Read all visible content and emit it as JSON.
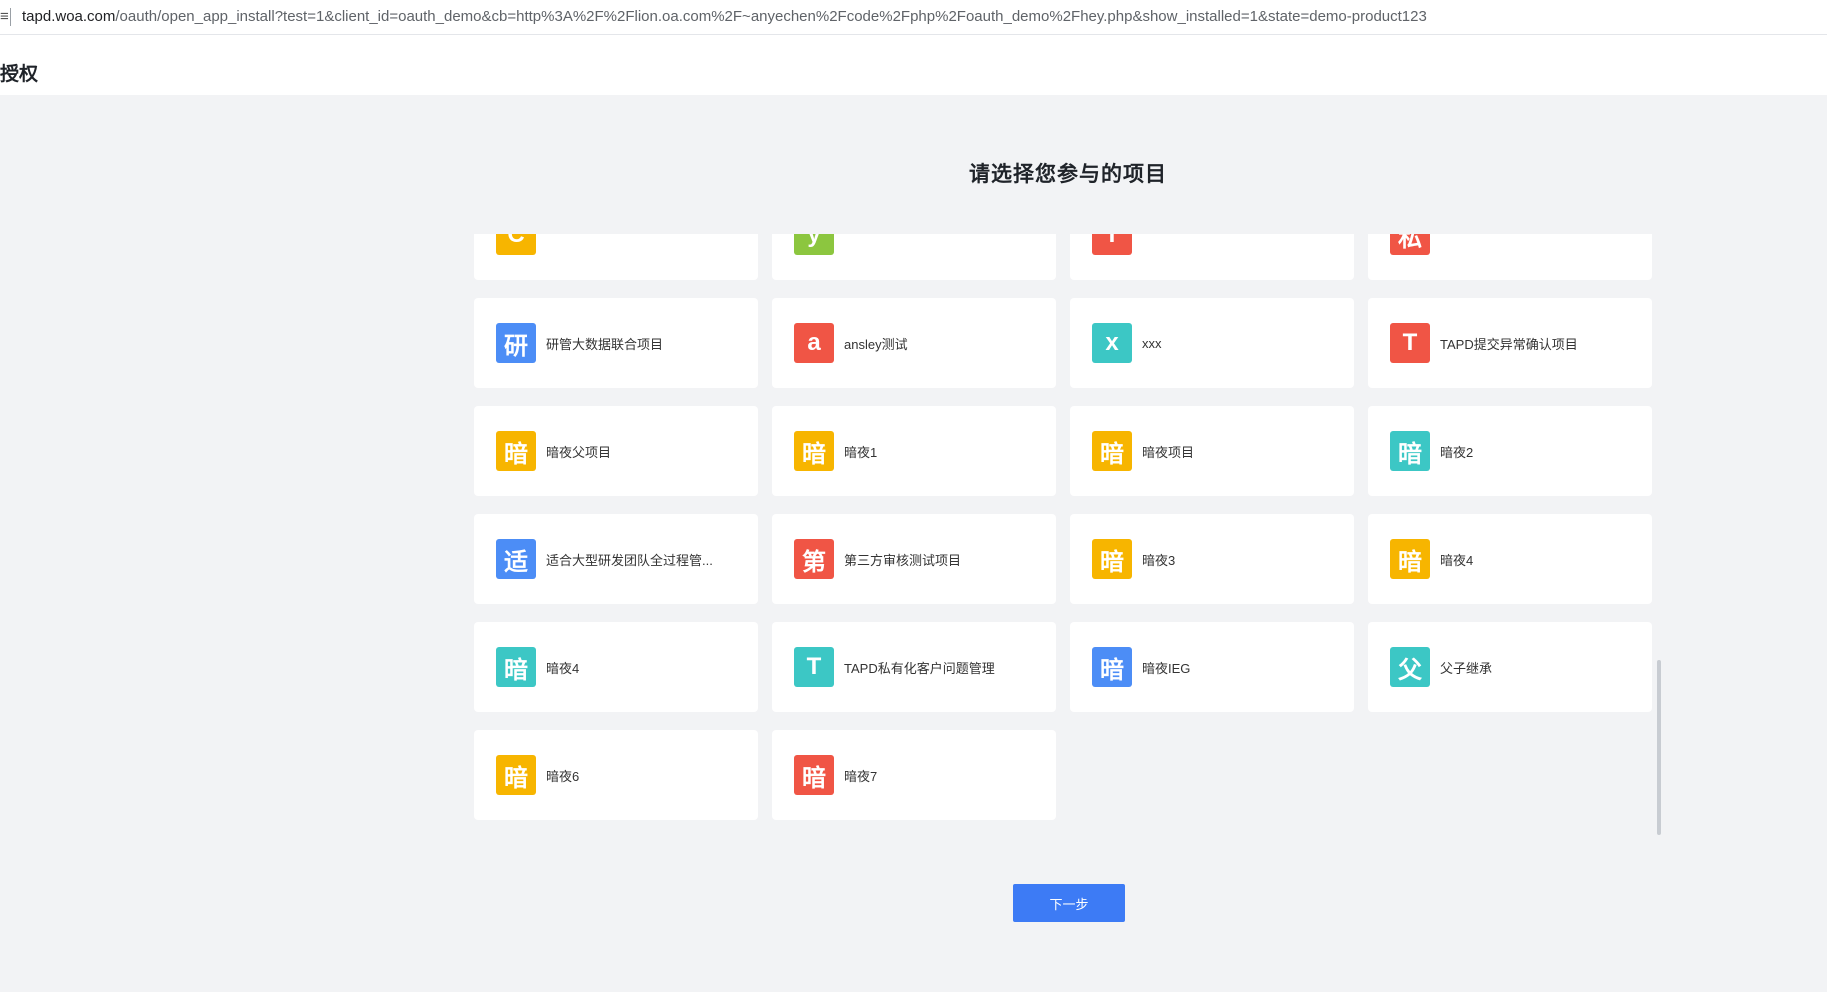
{
  "browser": {
    "prefix": "≡",
    "url_host": "tapd.woa.com",
    "url_path": "/oauth/open_app_install?test=1&client_id=oauth_demo&cb=http%3A%2F%2Flion.oa.com%2F~anyechen%2Fcode%2Fphp%2Foauth_demo%2Fhey.php&show_installed=1&state=demo-product123"
  },
  "header": {
    "title": "授权"
  },
  "main": {
    "title": "请选择您参与的项目",
    "next_label": "下一步"
  },
  "projects": [
    {
      "icon": "C",
      "name": "",
      "color": "#f7b500"
    },
    {
      "icon": "y",
      "name": "",
      "color": "#8cc63f"
    },
    {
      "icon": "T",
      "name": "",
      "color": "#f05545"
    },
    {
      "icon": "私",
      "name": "",
      "color": "#f05545"
    },
    {
      "icon": "研",
      "name": "研管大数据联合项目",
      "color": "#4c8df6"
    },
    {
      "icon": "a",
      "name": "ansley测试",
      "color": "#f05545"
    },
    {
      "icon": "x",
      "name": "xxx",
      "color": "#3cc7c5"
    },
    {
      "icon": "T",
      "name": "TAPD提交异常确认项目",
      "color": "#f05545"
    },
    {
      "icon": "暗",
      "name": "暗夜父项目",
      "color": "#f7b500"
    },
    {
      "icon": "暗",
      "name": "暗夜1",
      "color": "#f7b500"
    },
    {
      "icon": "暗",
      "name": "暗夜项目",
      "color": "#f7b500"
    },
    {
      "icon": "暗",
      "name": "暗夜2",
      "color": "#3cc7c5"
    },
    {
      "icon": "适",
      "name": "适合大型研发团队全过程管...",
      "color": "#4c8df6"
    },
    {
      "icon": "第",
      "name": "第三方审核测试项目",
      "color": "#f05545"
    },
    {
      "icon": "暗",
      "name": "暗夜3",
      "color": "#f7b500"
    },
    {
      "icon": "暗",
      "name": "暗夜4",
      "color": "#f7b500"
    },
    {
      "icon": "暗",
      "name": "暗夜4",
      "color": "#3cc7c5"
    },
    {
      "icon": "T",
      "name": "TAPD私有化客户问题管理",
      "color": "#3cc7c5"
    },
    {
      "icon": "暗",
      "name": "暗夜IEG",
      "color": "#4c8df6"
    },
    {
      "icon": "父",
      "name": "父子继承",
      "color": "#3cc7c5"
    },
    {
      "icon": "暗",
      "name": "暗夜6",
      "color": "#f7b500"
    },
    {
      "icon": "暗",
      "name": "暗夜7",
      "color": "#f05545"
    }
  ]
}
